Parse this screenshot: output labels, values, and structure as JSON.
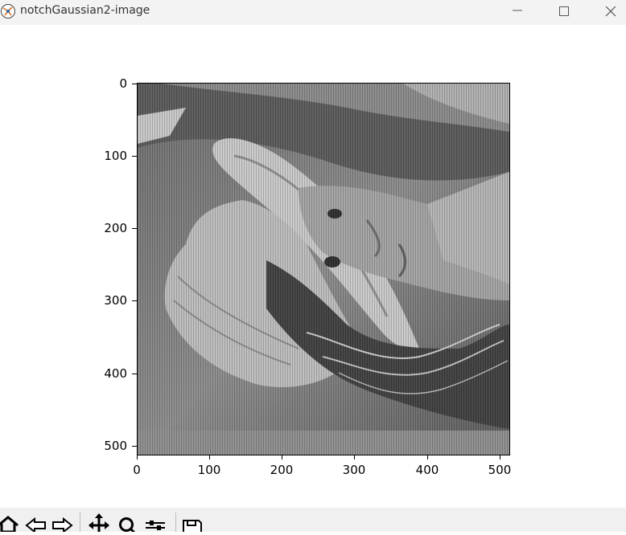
{
  "window": {
    "title": "notchGaussian2-image"
  },
  "axes": {
    "y_ticks": [
      "0",
      "100",
      "200",
      "300",
      "400",
      "500"
    ],
    "x_ticks": [
      "0",
      "100",
      "200",
      "300",
      "400",
      "500"
    ]
  },
  "toolbar": {
    "buttons": [
      {
        "icon": "home-icon"
      },
      {
        "icon": "back-arrow-icon"
      },
      {
        "icon": "forward-arrow-icon"
      },
      {
        "icon": "pan-icon"
      },
      {
        "icon": "zoom-icon"
      },
      {
        "icon": "configure-subplots-icon"
      },
      {
        "icon": "save-icon"
      }
    ]
  }
}
